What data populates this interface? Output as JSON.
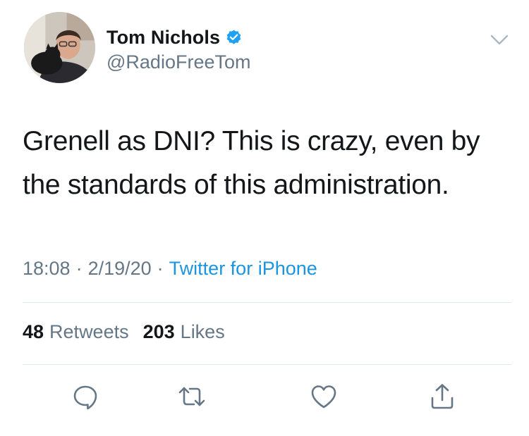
{
  "user": {
    "display_name": "Tom Nichols",
    "handle": "@RadioFreeTom",
    "verified": true,
    "avatar_icon": "profile-photo"
  },
  "tweet": {
    "text": "Grenell as DNI? This is crazy, even by\nthe standards of this administration.",
    "time": "18:08",
    "date": "2/19/20",
    "separator": "·",
    "source": "Twitter for iPhone"
  },
  "stats": {
    "retweets_count": "48",
    "retweets_label": "Retweets",
    "likes_count": "203",
    "likes_label": "Likes"
  },
  "actions": {
    "reply_icon": "speech-bubble",
    "retweet_icon": "retweet-arrows",
    "like_icon": "heart",
    "share_icon": "share-up-arrow"
  },
  "colors": {
    "text": "#14171a",
    "secondary": "#657786",
    "link": "#1b95e0",
    "verified": "#1da1f2",
    "divider": "#e1e8ed"
  }
}
